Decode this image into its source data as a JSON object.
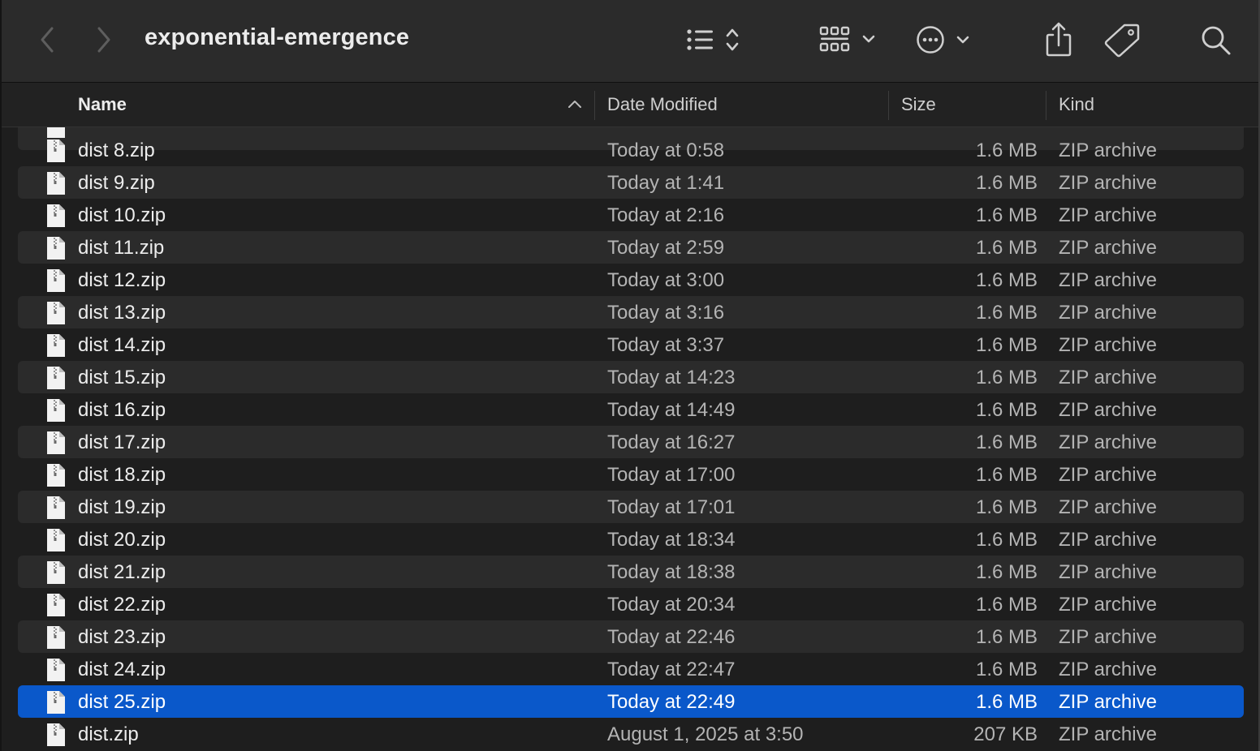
{
  "window": {
    "title": "exponential-emergence"
  },
  "toolbar": {
    "back_icon": "chevron-left-icon",
    "forward_icon": "chevron-right-icon",
    "view_icon": "list-view-icon",
    "group_icon": "group-grid-icon",
    "action_icon": "ellipsis-circle-icon",
    "share_icon": "share-icon",
    "tag_icon": "tag-icon",
    "search_icon": "search-icon"
  },
  "columns": {
    "name": "Name",
    "date": "Date Modified",
    "size": "Size",
    "kind": "Kind"
  },
  "files": [
    {
      "name": "dist 8.zip",
      "date": "Today at 0:58",
      "size": "1.6 MB",
      "kind": "ZIP archive"
    },
    {
      "name": "dist 9.zip",
      "date": "Today at 1:41",
      "size": "1.6 MB",
      "kind": "ZIP archive"
    },
    {
      "name": "dist 10.zip",
      "date": "Today at 2:16",
      "size": "1.6 MB",
      "kind": "ZIP archive"
    },
    {
      "name": "dist 11.zip",
      "date": "Today at 2:59",
      "size": "1.6 MB",
      "kind": "ZIP archive"
    },
    {
      "name": "dist 12.zip",
      "date": "Today at 3:00",
      "size": "1.6 MB",
      "kind": "ZIP archive"
    },
    {
      "name": "dist 13.zip",
      "date": "Today at 3:16",
      "size": "1.6 MB",
      "kind": "ZIP archive"
    },
    {
      "name": "dist 14.zip",
      "date": "Today at 3:37",
      "size": "1.6 MB",
      "kind": "ZIP archive"
    },
    {
      "name": "dist 15.zip",
      "date": "Today at 14:23",
      "size": "1.6 MB",
      "kind": "ZIP archive"
    },
    {
      "name": "dist 16.zip",
      "date": "Today at 14:49",
      "size": "1.6 MB",
      "kind": "ZIP archive"
    },
    {
      "name": "dist 17.zip",
      "date": "Today at 16:27",
      "size": "1.6 MB",
      "kind": "ZIP archive"
    },
    {
      "name": "dist 18.zip",
      "date": "Today at 17:00",
      "size": "1.6 MB",
      "kind": "ZIP archive"
    },
    {
      "name": "dist 19.zip",
      "date": "Today at 17:01",
      "size": "1.6 MB",
      "kind": "ZIP archive"
    },
    {
      "name": "dist 20.zip",
      "date": "Today at 18:34",
      "size": "1.6 MB",
      "kind": "ZIP archive"
    },
    {
      "name": "dist 21.zip",
      "date": "Today at 18:38",
      "size": "1.6 MB",
      "kind": "ZIP archive"
    },
    {
      "name": "dist 22.zip",
      "date": "Today at 20:34",
      "size": "1.6 MB",
      "kind": "ZIP archive"
    },
    {
      "name": "dist 23.zip",
      "date": "Today at 22:46",
      "size": "1.6 MB",
      "kind": "ZIP archive"
    },
    {
      "name": "dist 24.zip",
      "date": "Today at 22:47",
      "size": "1.6 MB",
      "kind": "ZIP archive"
    },
    {
      "name": "dist 25.zip",
      "date": "Today at 22:49",
      "size": "1.6 MB",
      "kind": "ZIP archive",
      "selected": true
    },
    {
      "name": "dist.zip",
      "date": "August 1, 2025 at 3:50",
      "size": "207 KB",
      "kind": "ZIP archive"
    }
  ],
  "colors": {
    "selection": "#0a58ca",
    "background": "#1e1e1e",
    "toolbar": "#2b2b2b",
    "alt_row": "#2b2b2b"
  }
}
